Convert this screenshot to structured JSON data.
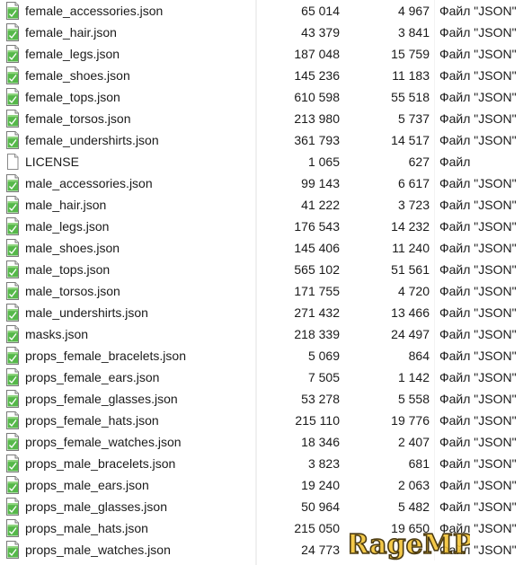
{
  "files": [
    {
      "name": "female_accessories.json",
      "size": "65 014",
      "packed": "4 967",
      "type": "Файл \"JSON\"",
      "icon": "json-file-icon"
    },
    {
      "name": "female_hair.json",
      "size": "43 379",
      "packed": "3 841",
      "type": "Файл \"JSON\"",
      "icon": "json-file-icon"
    },
    {
      "name": "female_legs.json",
      "size": "187 048",
      "packed": "15 759",
      "type": "Файл \"JSON\"",
      "icon": "json-file-icon"
    },
    {
      "name": "female_shoes.json",
      "size": "145 236",
      "packed": "11 183",
      "type": "Файл \"JSON\"",
      "icon": "json-file-icon"
    },
    {
      "name": "female_tops.json",
      "size": "610 598",
      "packed": "55 518",
      "type": "Файл \"JSON\"",
      "icon": "json-file-icon"
    },
    {
      "name": "female_torsos.json",
      "size": "213 980",
      "packed": "5 737",
      "type": "Файл \"JSON\"",
      "icon": "json-file-icon"
    },
    {
      "name": "female_undershirts.json",
      "size": "361 793",
      "packed": "14 517",
      "type": "Файл \"JSON\"",
      "icon": "json-file-icon"
    },
    {
      "name": "LICENSE",
      "size": "1 065",
      "packed": "627",
      "type": "Файл",
      "icon": "blank-file-icon"
    },
    {
      "name": "male_accessories.json",
      "size": "99 143",
      "packed": "6 617",
      "type": "Файл \"JSON\"",
      "icon": "json-file-icon"
    },
    {
      "name": "male_hair.json",
      "size": "41 222",
      "packed": "3 723",
      "type": "Файл \"JSON\"",
      "icon": "json-file-icon"
    },
    {
      "name": "male_legs.json",
      "size": "176 543",
      "packed": "14 232",
      "type": "Файл \"JSON\"",
      "icon": "json-file-icon"
    },
    {
      "name": "male_shoes.json",
      "size": "145 406",
      "packed": "11 240",
      "type": "Файл \"JSON\"",
      "icon": "json-file-icon"
    },
    {
      "name": "male_tops.json",
      "size": "565 102",
      "packed": "51 561",
      "type": "Файл \"JSON\"",
      "icon": "json-file-icon"
    },
    {
      "name": "male_torsos.json",
      "size": "171 755",
      "packed": "4 720",
      "type": "Файл \"JSON\"",
      "icon": "json-file-icon"
    },
    {
      "name": "male_undershirts.json",
      "size": "271 432",
      "packed": "13 466",
      "type": "Файл \"JSON\"",
      "icon": "json-file-icon"
    },
    {
      "name": "masks.json",
      "size": "218 339",
      "packed": "24 497",
      "type": "Файл \"JSON\"",
      "icon": "json-file-icon"
    },
    {
      "name": "props_female_bracelets.json",
      "size": "5 069",
      "packed": "864",
      "type": "Файл \"JSON\"",
      "icon": "json-file-icon"
    },
    {
      "name": "props_female_ears.json",
      "size": "7 505",
      "packed": "1 142",
      "type": "Файл \"JSON\"",
      "icon": "json-file-icon"
    },
    {
      "name": "props_female_glasses.json",
      "size": "53 278",
      "packed": "5 558",
      "type": "Файл \"JSON\"",
      "icon": "json-file-icon"
    },
    {
      "name": "props_female_hats.json",
      "size": "215 110",
      "packed": "19 776",
      "type": "Файл \"JSON\"",
      "icon": "json-file-icon"
    },
    {
      "name": "props_female_watches.json",
      "size": "18 346",
      "packed": "2 407",
      "type": "Файл \"JSON\"",
      "icon": "json-file-icon"
    },
    {
      "name": "props_male_bracelets.json",
      "size": "3 823",
      "packed": "681",
      "type": "Файл \"JSON\"",
      "icon": "json-file-icon"
    },
    {
      "name": "props_male_ears.json",
      "size": "19 240",
      "packed": "2 063",
      "type": "Файл \"JSON\"",
      "icon": "json-file-icon"
    },
    {
      "name": "props_male_glasses.json",
      "size": "50 964",
      "packed": "5 482",
      "type": "Файл \"JSON\"",
      "icon": "json-file-icon"
    },
    {
      "name": "props_male_hats.json",
      "size": "215 050",
      "packed": "19 650",
      "type": "Файл \"JSON\"",
      "icon": "json-file-icon"
    },
    {
      "name": "props_male_watches.json",
      "size": "24 773",
      "packed": "",
      "type": "Файл \"JSON\"",
      "icon": "json-file-icon"
    }
  ],
  "watermark": {
    "text": "RageMP",
    "fill_color": "#f2c230",
    "stroke_color": "#4a3a12"
  },
  "colors": {
    "icon_green": "#56b84a",
    "icon_outline": "#7a7a7a"
  }
}
